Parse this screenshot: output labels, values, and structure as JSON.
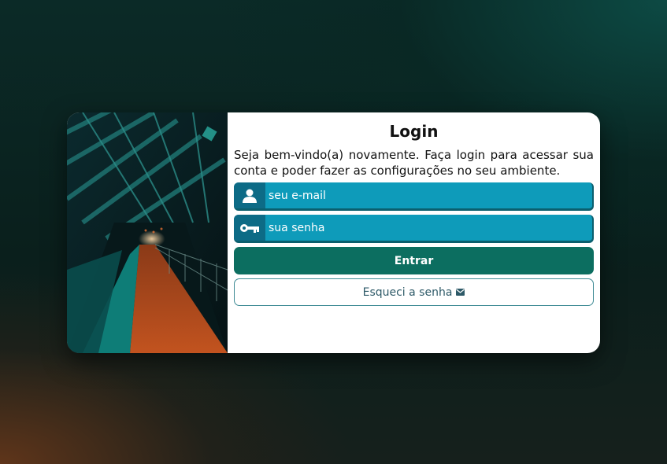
{
  "login": {
    "title": "Login",
    "subtitle": "Seja bem-vindo(a) novamente. Faça login para acessar sua conta e poder fazer as configurações no seu ambiente.",
    "email_placeholder": "seu e-mail",
    "password_placeholder": "sua senha",
    "submit_label": "Entrar",
    "forgot_label": "Esqueci a senha"
  },
  "icons": {
    "email_field": "user-icon",
    "password_field": "key-icon",
    "forgot": "envelope-icon"
  },
  "colors": {
    "field_bg": "#0e9bba",
    "primary_button": "#0c6e60",
    "card_bg": "#ffffff"
  }
}
